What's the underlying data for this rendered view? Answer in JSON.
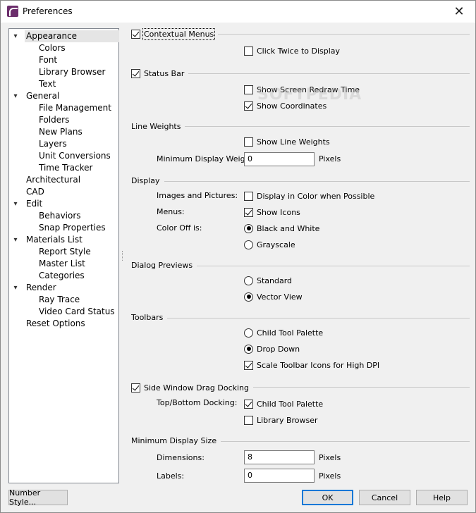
{
  "window": {
    "title": "Preferences",
    "app_icon": "app-logo-icon",
    "close_icon": "close-icon"
  },
  "tree": {
    "items": [
      {
        "label": "Appearance",
        "level": 0,
        "expanded": true,
        "selected": true
      },
      {
        "label": "Colors",
        "level": 1
      },
      {
        "label": "Font",
        "level": 1
      },
      {
        "label": "Library Browser",
        "level": 1
      },
      {
        "label": "Text",
        "level": 1
      },
      {
        "label": "General",
        "level": 0,
        "expanded": true
      },
      {
        "label": "File Management",
        "level": 1
      },
      {
        "label": "Folders",
        "level": 1
      },
      {
        "label": "New Plans",
        "level": 1
      },
      {
        "label": "Layers",
        "level": 1
      },
      {
        "label": "Unit Conversions",
        "level": 1
      },
      {
        "label": "Time Tracker",
        "level": 1
      },
      {
        "label": "Architectural",
        "level": 0
      },
      {
        "label": "CAD",
        "level": 0
      },
      {
        "label": "Edit",
        "level": 0,
        "expanded": true
      },
      {
        "label": "Behaviors",
        "level": 1
      },
      {
        "label": "Snap Properties",
        "level": 1
      },
      {
        "label": "Materials List",
        "level": 0,
        "expanded": true
      },
      {
        "label": "Report Style",
        "level": 1
      },
      {
        "label": "Master List",
        "level": 1
      },
      {
        "label": "Categories",
        "level": 1
      },
      {
        "label": "Render",
        "level": 0,
        "expanded": true
      },
      {
        "label": "Ray Trace",
        "level": 1
      },
      {
        "label": "Video Card Status",
        "level": 1
      },
      {
        "label": "Reset Options",
        "level": 0
      }
    ]
  },
  "contextual_menus": {
    "label": "Contextual Menus",
    "checked": true,
    "click_twice": {
      "label": "Click Twice to Display",
      "checked": false
    }
  },
  "status_bar": {
    "label": "Status Bar",
    "checked": true,
    "screen_redraw": {
      "label": "Show Screen Redraw Time",
      "checked": false
    },
    "coordinates": {
      "label": "Show Coordinates",
      "checked": true
    }
  },
  "watermark": "SOFTPEDIA",
  "line_weights": {
    "title": "Line Weights",
    "show": {
      "label": "Show Line Weights",
      "checked": false
    },
    "min_label": "Minimum Display Weight:",
    "min_value": "0",
    "unit": "Pixels"
  },
  "display": {
    "title": "Display",
    "images_label": "Images and Pictures:",
    "images_option": {
      "label": "Display in Color when Possible",
      "checked": false
    },
    "menus_label": "Menus:",
    "menus_option": {
      "label": "Show Icons",
      "checked": true
    },
    "color_off_label": "Color Off is:",
    "bw": {
      "label": "Black and White",
      "checked": true
    },
    "gray": {
      "label": "Grayscale",
      "checked": false
    }
  },
  "dialog_previews": {
    "title": "Dialog Previews",
    "standard": {
      "label": "Standard",
      "checked": false
    },
    "vector": {
      "label": "Vector View",
      "checked": true
    }
  },
  "toolbars": {
    "title": "Toolbars",
    "child": {
      "label": "Child Tool Palette",
      "checked": false
    },
    "drop": {
      "label": "Drop Down",
      "checked": true
    },
    "scale": {
      "label": "Scale Toolbar Icons for High DPI",
      "checked": true
    }
  },
  "side_window": {
    "label": "Side Window Drag Docking",
    "checked": true,
    "tb_label": "Top/Bottom Docking:",
    "child": {
      "label": "Child Tool Palette",
      "checked": true
    },
    "library": {
      "label": "Library Browser",
      "checked": false
    }
  },
  "min_display_size": {
    "title": "Minimum Display Size",
    "dimensions_label": "Dimensions:",
    "dimensions_value": "8",
    "labels_label": "Labels:",
    "labels_value": "0",
    "unit": "Pixels"
  },
  "buttons": {
    "number_style": "Number Style...",
    "ok": "OK",
    "cancel": "Cancel",
    "help": "Help"
  }
}
